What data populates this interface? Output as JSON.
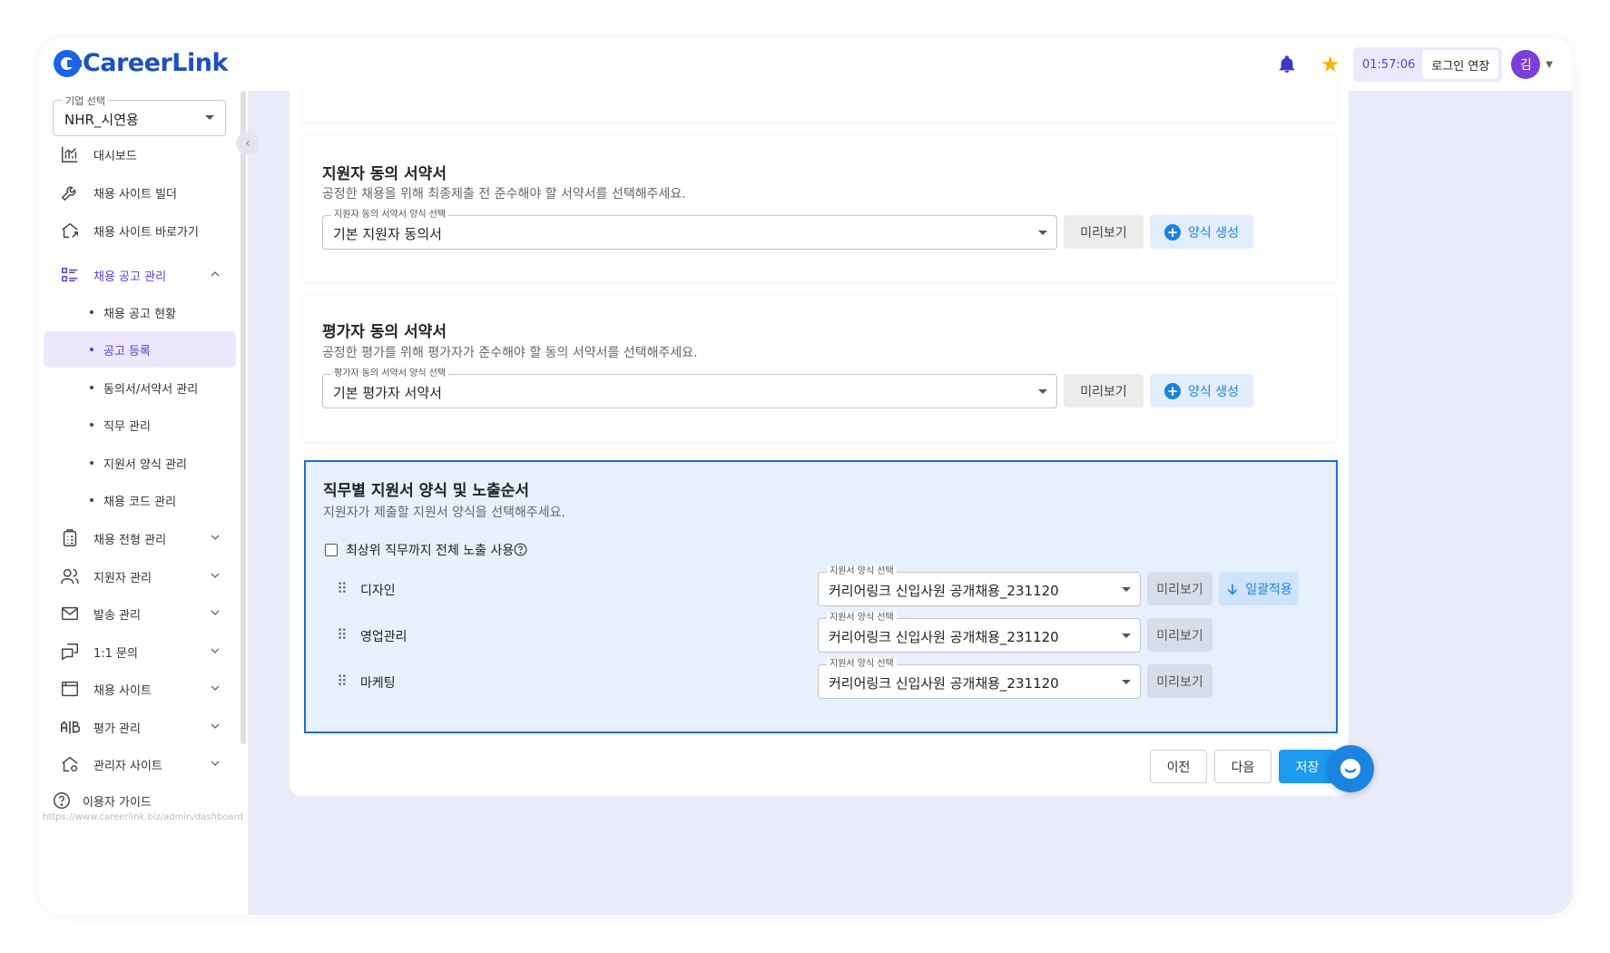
{
  "header": {
    "logo_text": "CareerLink",
    "timer": "01:57:06",
    "extend_label": "로그인 연장",
    "avatar_initial": "김"
  },
  "sidebar": {
    "company_select": {
      "legend": "기업 선택",
      "value": "NHR_시연용"
    },
    "items": [
      {
        "label": "대시보드",
        "icon": "chart-icon"
      },
      {
        "label": "채용 사이트 빌더",
        "icon": "wrench-icon"
      },
      {
        "label": "채용 사이트 바로가기",
        "icon": "home-link-icon"
      },
      {
        "label": "채용 공고 관리",
        "icon": "list-icon",
        "expanded": true
      },
      {
        "label": "채용 전형 관리",
        "icon": "clipboard-icon"
      },
      {
        "label": "지원자 관리",
        "icon": "users-icon"
      },
      {
        "label": "발송 관리",
        "icon": "mail-icon"
      },
      {
        "label": "1:1 문의",
        "icon": "chat-icon"
      },
      {
        "label": "채용 사이트",
        "icon": "browser-icon"
      },
      {
        "label": "평가 관리",
        "icon": "ab-icon"
      },
      {
        "label": "관리자 사이트",
        "icon": "admin-home-icon"
      }
    ],
    "sub_items": [
      {
        "label": "채용 공고 현황"
      },
      {
        "label": "공고 등록",
        "selected": true
      },
      {
        "label": "동의서/서약서 관리"
      },
      {
        "label": "직무 관리"
      },
      {
        "label": "지원서 양식 관리"
      },
      {
        "label": "채용 코드 관리"
      }
    ],
    "guide_label": "이용자 가이드",
    "url_hint": "https://www.careerlink.biz/admin/dashboard"
  },
  "applicant_pledge": {
    "title": "지원자 동의 서약서",
    "desc": "공정한 채용을 위해 최종제출 전 준수해야 할 서약서를 선택해주세요.",
    "select_legend": "지원자 동의 서약서 양식 선택",
    "select_value": "기본 지원자 동의서",
    "preview_label": "미리보기",
    "create_label": "양식 생성"
  },
  "evaluator_pledge": {
    "title": "평가자 동의 서약서",
    "desc": "공정한 평가를 위해 평가자가 준수해야 할 동의 서약서를 선택해주세요.",
    "select_legend": "평가자 동의 서약서 양식 선택",
    "select_value": "기본 평가자 서약서",
    "preview_label": "미리보기",
    "create_label": "양식 생성"
  },
  "job_forms": {
    "title": "직무별 지원서 양식 및 노출순서",
    "desc": "지원자가 제출할 지원서 양식을 선택해주세요.",
    "checkbox_label": "최상위 직무까지 전체 노출 사용",
    "rows": [
      {
        "job": "디자인",
        "legend": "지원서 양식 선택",
        "value": "커리어링크 신입사원 공개채용_231120",
        "preview": "미리보기",
        "apply": "일괄적용"
      },
      {
        "job": "영업관리",
        "legend": "지원서 양식 선택",
        "value": "커리어링크 신입사원 공개채용_231120",
        "preview": "미리보기"
      },
      {
        "job": "마케팅",
        "legend": "지원서 양식 선택",
        "value": "커리어링크 신입사원 공개채용_231120",
        "preview": "미리보기"
      }
    ]
  },
  "footer": {
    "prev_label": "이전",
    "next_label": "다음",
    "save_label": "저장"
  },
  "colors": {
    "brand": "#1d4fc2",
    "accent_purple": "#5a3fd3",
    "primary_blue": "#1c9bf0",
    "highlight_border": "#1b6fd6"
  }
}
